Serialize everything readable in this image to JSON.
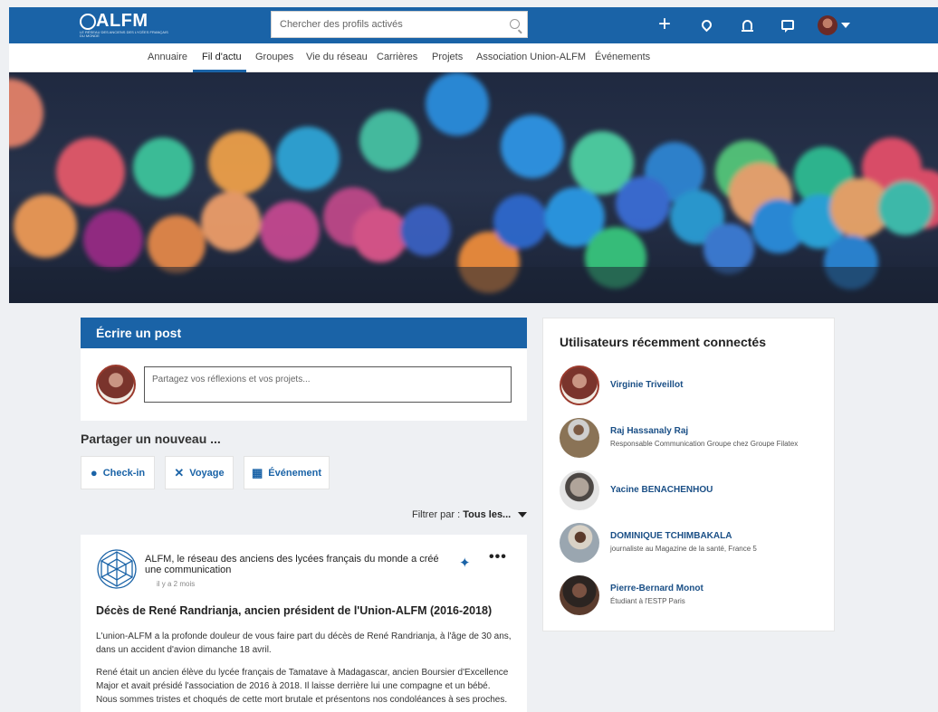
{
  "header": {
    "logo_word": "ALFM",
    "logo_tagline": "Le réseau des anciens des lycées français du monde",
    "search_placeholder": "Chercher des profils activés"
  },
  "nav": {
    "items": [
      "Annuaire",
      "Fil d'actu",
      "Groupes",
      "Vie du réseau",
      "Carrières",
      "Projets",
      "Association Union-ALFM",
      "Événements"
    ],
    "active": "Fil d'actu"
  },
  "write": {
    "title": "Écrire un post",
    "placeholder": "Partagez vos réflexions et vos projets..."
  },
  "share": {
    "title": "Partager un nouveau ...",
    "buttons": [
      {
        "label": "Check-in",
        "icon": "map-pin-icon"
      },
      {
        "label": "Voyage",
        "icon": "plane-icon"
      },
      {
        "label": "Événement",
        "icon": "calendar-icon"
      }
    ]
  },
  "filter": {
    "label": "Filtrer par :",
    "value": "Tous les..."
  },
  "post": {
    "author_line": "ALFM, le réseau des anciens des lycées français du monde a créé une communication",
    "time": "il y a 2 mois",
    "title": "Décès de René Randrianja, ancien président de l'Union-ALFM (2016-2018)",
    "para1": "L'union-ALFM a la profonde douleur de vous faire part du décès de René Randrianja, à l'âge de 30 ans, dans un accident d'avion dimanche 18 avril.",
    "para2": "René était un ancien élève du lycée français de Tamatave à Madagascar, ancien Boursier d'Excellence Major et avait présidé l'association de 2016 à 2018. Il laisse derrière lui une compagne et un bébé. Nous sommes tristes et choqués de cette mort brutale et présentons nos condoléances à ses proches."
  },
  "recent_users": {
    "title": "Utilisateurs récemment connectés",
    "users": [
      {
        "name": "Virginie Triveillot",
        "role": ""
      },
      {
        "name": "Raj Hassanaly Raj",
        "role": "Responsable Communication Groupe chez Groupe Filatex"
      },
      {
        "name": "Yacine BENACHENHOU",
        "role": ""
      },
      {
        "name": "DOMINIQUE TCHIMBAKALA",
        "role": "journaliste au Magazine de la santé, France 5"
      },
      {
        "name": "Pierre-Bernard Monot",
        "role": "Étudiant à l'ESTP Paris"
      }
    ]
  },
  "colors": {
    "brand": "#1a63a7",
    "link": "#1a4f86",
    "background": "#eef0f3"
  }
}
